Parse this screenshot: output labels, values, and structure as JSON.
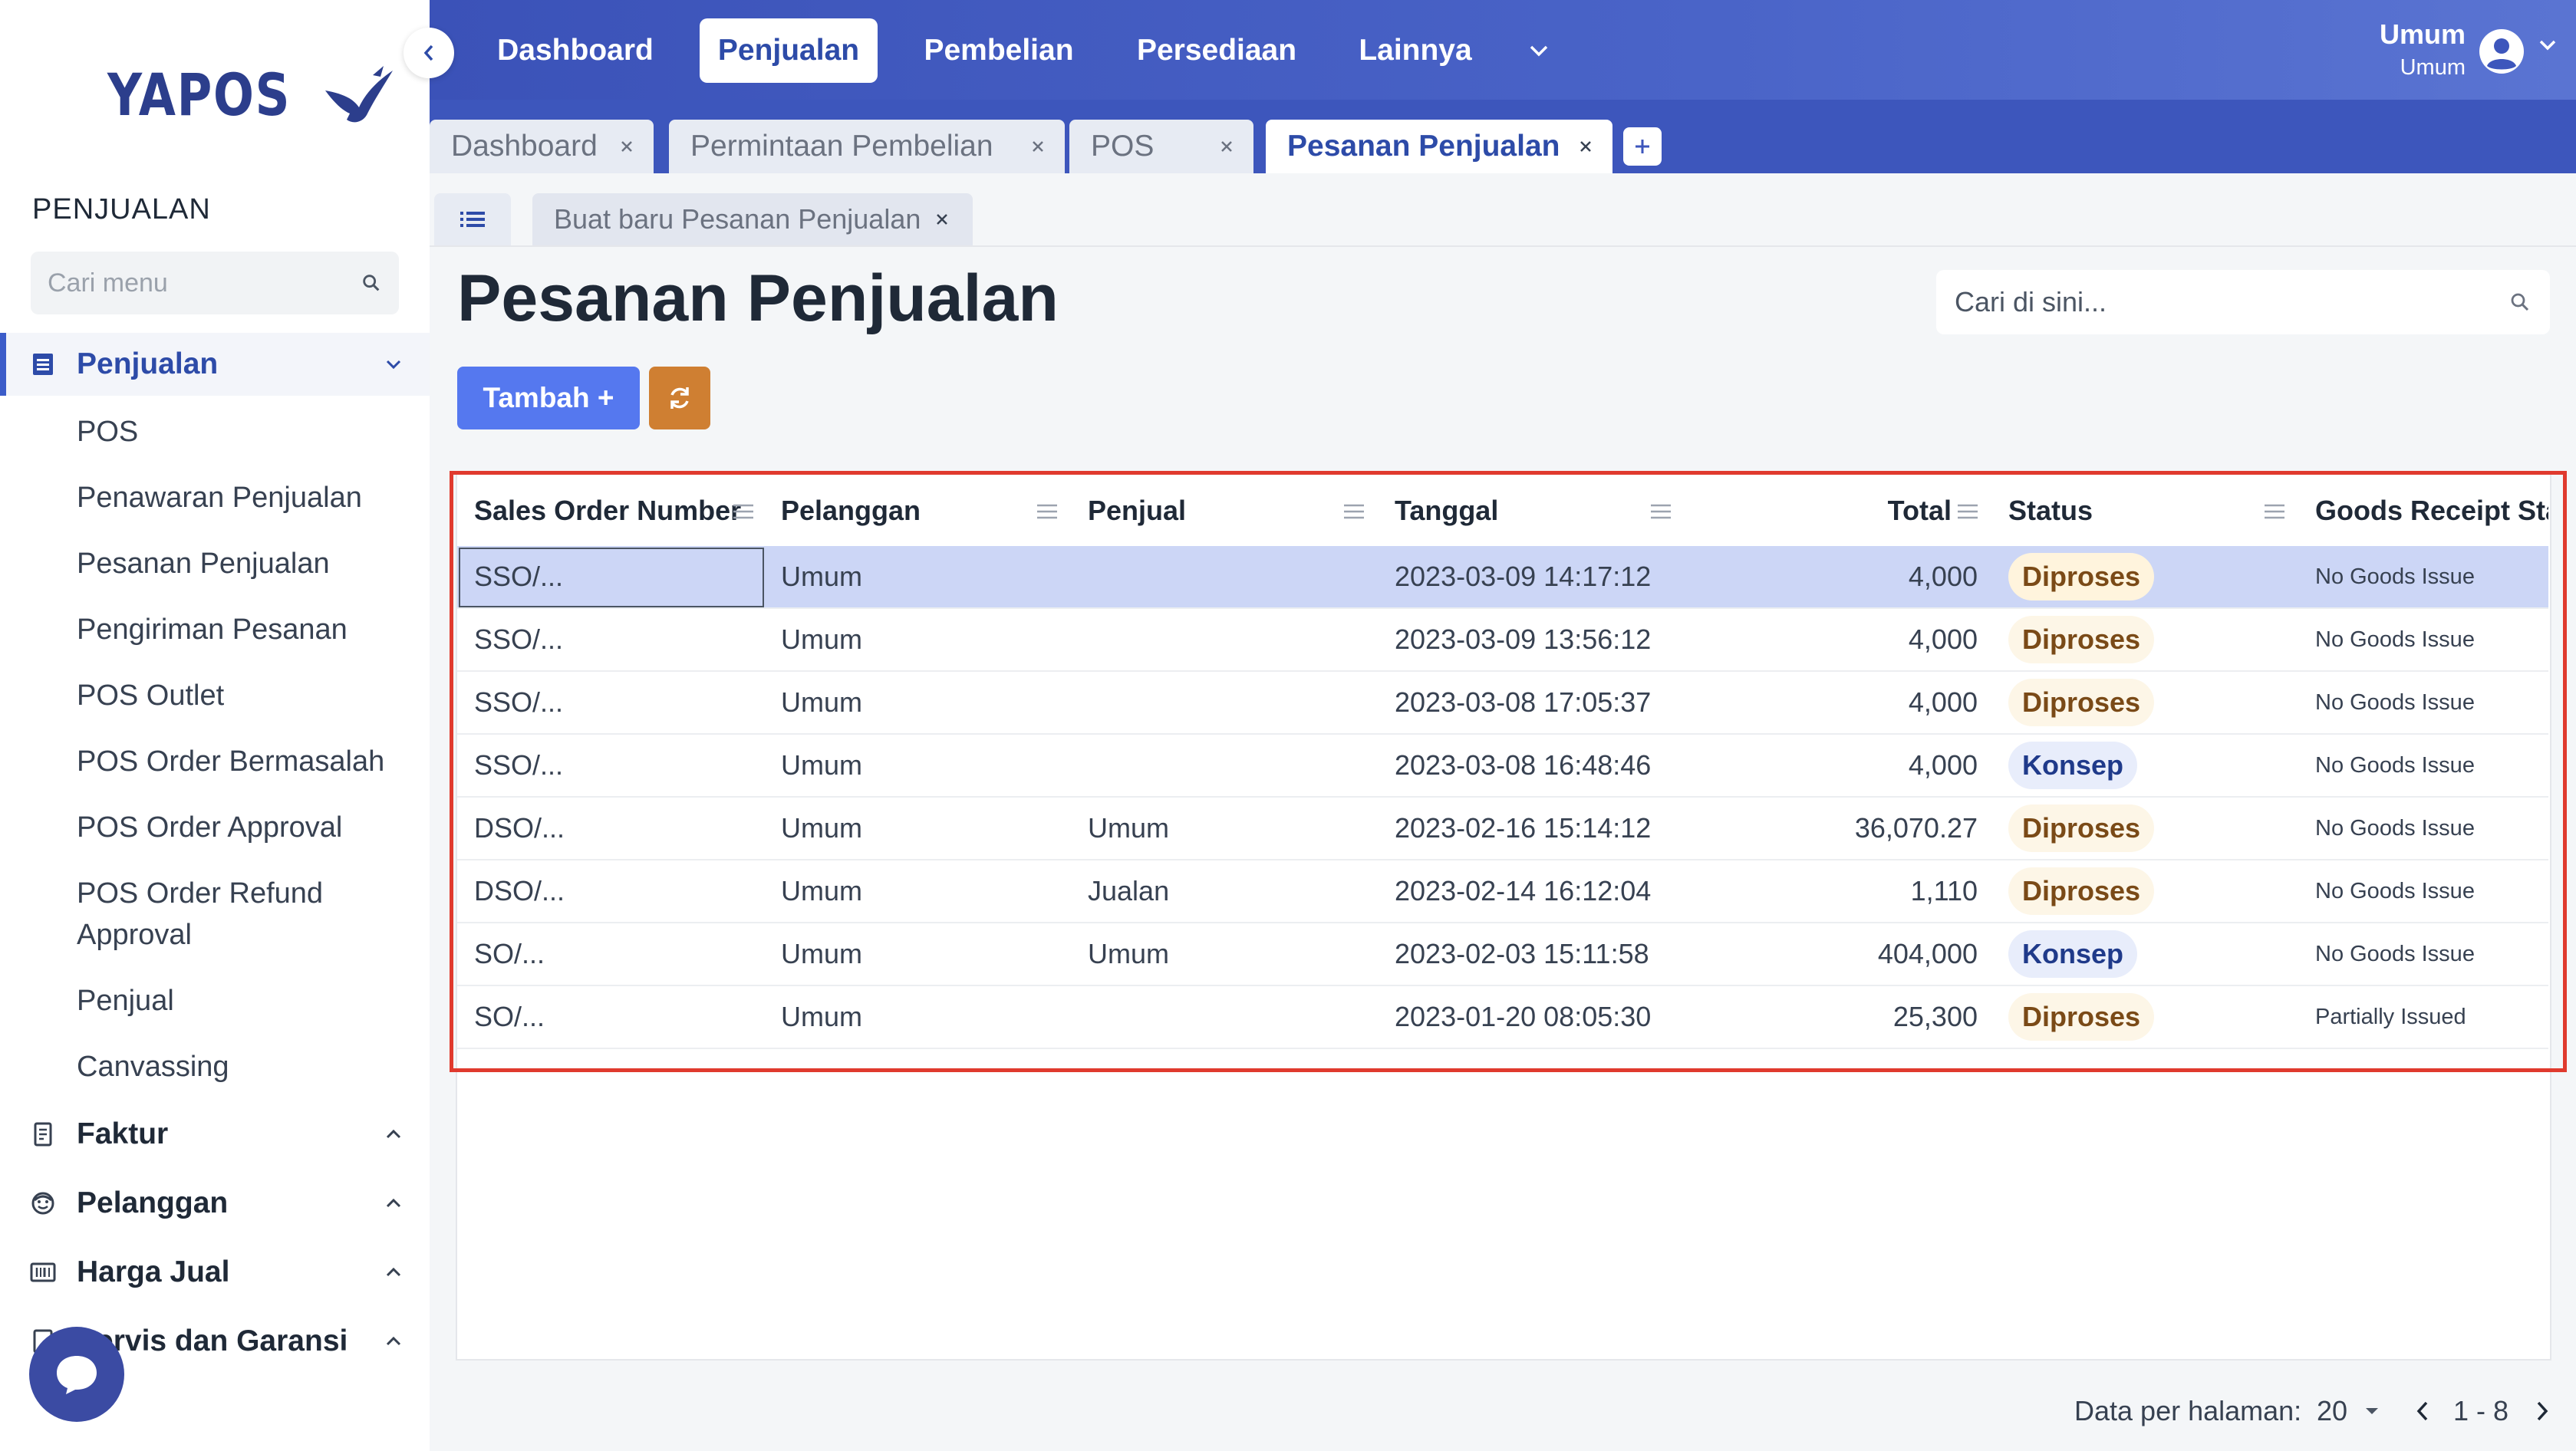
{
  "brand": {
    "logo_text": "YAPOS"
  },
  "sidebar": {
    "section_title": "PENJUALAN",
    "search_placeholder": "Cari menu",
    "groups": [
      {
        "label": "Penjualan",
        "icon": "list-icon",
        "expanded": true,
        "items": [
          "POS",
          "Penawaran Penjualan",
          "Pesanan Penjualan",
          "Pengiriman Pesanan",
          "POS Outlet",
          "POS Order Bermasalah",
          "POS Order Approval",
          "POS Order Refund Approval",
          "Penjual",
          "Canvassing"
        ]
      },
      {
        "label": "Faktur",
        "icon": "receipt-icon"
      },
      {
        "label": "Pelanggan",
        "icon": "face-icon"
      },
      {
        "label": "Harga Jual",
        "icon": "barcode-icon"
      },
      {
        "label": "Servis dan Garansi",
        "icon": "document-icon"
      }
    ]
  },
  "topnav": {
    "items": [
      "Dashboard",
      "Penjualan",
      "Pembelian",
      "Persediaan",
      "Lainnya"
    ],
    "active": "Penjualan",
    "user": {
      "name": "Umum",
      "role": "Umum"
    }
  },
  "tabs": [
    {
      "label": "Dashboard"
    },
    {
      "label": "Permintaan Pembelian"
    },
    {
      "label": "POS"
    },
    {
      "label": "Pesanan Penjualan",
      "active": true
    }
  ],
  "subtabs": [
    {
      "label": "Buat baru Pesanan Penjualan"
    }
  ],
  "page": {
    "title": "Pesanan Penjualan",
    "search_placeholder": "Cari di sini...",
    "add_button": "Tambah +"
  },
  "table": {
    "columns": [
      "Sales Order Number",
      "Pelanggan",
      "Penjual",
      "Tanggal",
      "Total",
      "Status",
      "Goods Receipt Sta"
    ],
    "rows": [
      {
        "number": "SSO/...",
        "customer": "Umum",
        "seller": "",
        "date": "2023-03-09 14:17:12",
        "total": "4,000",
        "status": "Diproses",
        "goods": "No Goods Issue",
        "selected": true
      },
      {
        "number": "SSO/...",
        "customer": "Umum",
        "seller": "",
        "date": "2023-03-09 13:56:12",
        "total": "4,000",
        "status": "Diproses",
        "goods": "No Goods Issue"
      },
      {
        "number": "SSO/...",
        "customer": "Umum",
        "seller": "",
        "date": "2023-03-08 17:05:37",
        "total": "4,000",
        "status": "Diproses",
        "goods": "No Goods Issue"
      },
      {
        "number": "SSO/...",
        "customer": "Umum",
        "seller": "",
        "date": "2023-03-08 16:48:46",
        "total": "4,000",
        "status": "Konsep",
        "goods": "No Goods Issue"
      },
      {
        "number": "DSO/...",
        "customer": "Umum",
        "seller": "Umum",
        "date": "2023-02-16 15:14:12",
        "total": "36,070.27",
        "status": "Diproses",
        "goods": "No Goods Issue"
      },
      {
        "number": "DSO/...",
        "customer": "Umum",
        "seller": "Jualan",
        "date": "2023-02-14 16:12:04",
        "total": "1,110",
        "status": "Diproses",
        "goods": "No Goods Issue"
      },
      {
        "number": "SO/...",
        "customer": "Umum",
        "seller": "Umum",
        "date": "2023-02-03 15:11:58",
        "total": "404,000",
        "status": "Konsep",
        "goods": "No Goods Issue"
      },
      {
        "number": "SO/...",
        "customer": "Umum",
        "seller": "",
        "date": "2023-01-20 08:05:30",
        "total": "25,300",
        "status": "Diproses",
        "goods": "Partially Issued"
      }
    ]
  },
  "pagination": {
    "per_page_label": "Data per halaman:",
    "per_page_value": "20",
    "range": "1 - 8"
  },
  "colors": {
    "primary": "#3b52b8",
    "add_button": "#5578ef",
    "refresh_button": "#cf7f32",
    "selected_row": "#ccd6f6",
    "highlight": "#e03a2e"
  }
}
